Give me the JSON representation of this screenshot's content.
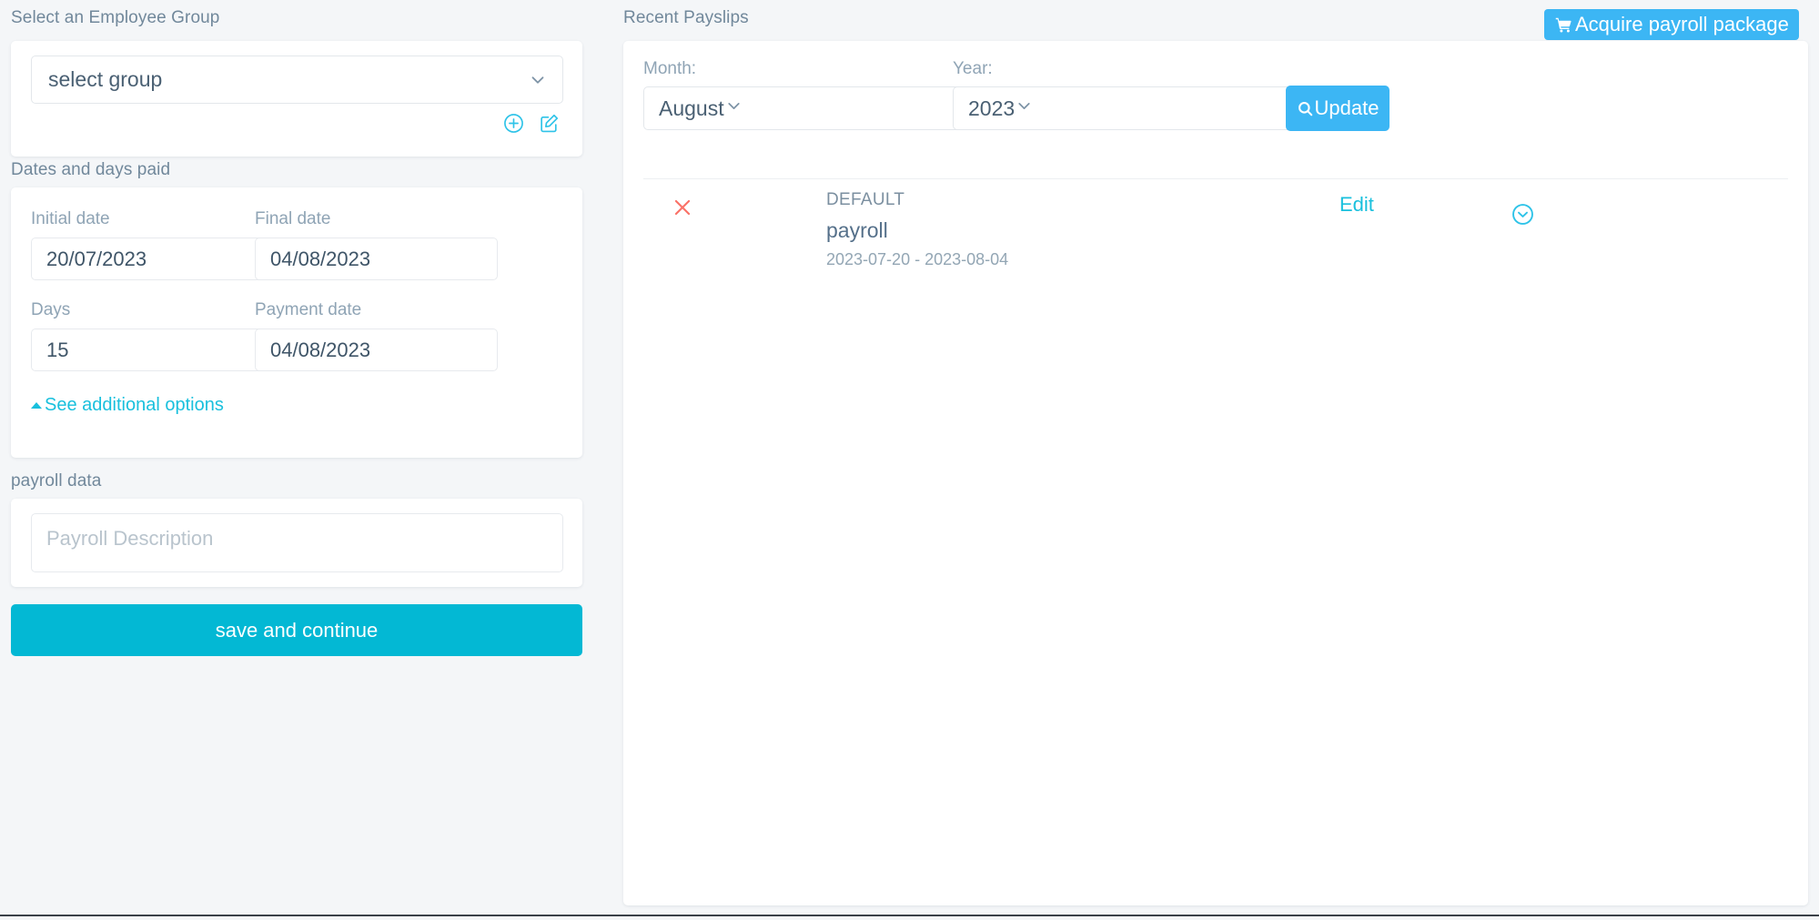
{
  "left_panel": {
    "employee_group": {
      "heading": "Select an Employee Group",
      "select_value": "select group",
      "add_icon": "circle-plus-icon",
      "edit_icon": "pencil-square-icon"
    },
    "dates": {
      "heading": "Dates and days paid",
      "initial_date_label": "Initial date",
      "initial_date_value": "20/07/2023",
      "final_date_label": "Final date",
      "final_date_value": "04/08/2023",
      "days_label": "Days",
      "days_value": "15",
      "payment_date_label": "Payment date",
      "payment_date_value": "04/08/2023",
      "additional_options_label": "See additional options",
      "additional_options_caret": "caret-up-icon"
    },
    "payroll_data": {
      "heading": "payroll data",
      "description_placeholder": "Payroll Description",
      "description_value": ""
    },
    "save_button_label": "save and continue"
  },
  "right_panel": {
    "heading": "Recent Payslips",
    "acquire_button_label": "Acquire payroll package",
    "acquire_button_icon": "shopping-cart-icon",
    "filters": {
      "month_label": "Month:",
      "month_value": "August",
      "year_label": "Year:",
      "year_value": "2023"
    },
    "update_button_label": "Update",
    "update_button_icon": "search-icon",
    "payslips": [
      {
        "type": "DEFAULT",
        "name": "payroll",
        "date_range": "2023-07-20 - 2023-08-04",
        "edit_label": "Edit",
        "delete_icon": "close-x-icon",
        "expand_icon": "chevron-down-circle-icon"
      }
    ]
  },
  "colors": {
    "page_background": "#f4f6f8",
    "accent_cyan": "#19c0dd",
    "accent_blue": "#3cb6f4",
    "save_button": "#03b8d4",
    "delete_red": "#fa7268",
    "heading_text": "#71889b"
  }
}
